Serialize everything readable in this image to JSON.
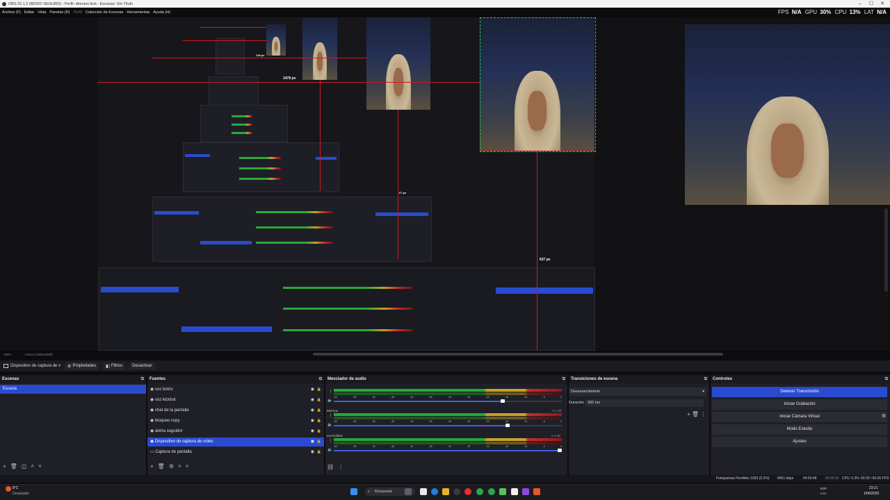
{
  "window": {
    "title": "OBS 31.1.2 (MODO SEGURO) - Perfil: directos kick - Escenas: Sin Título",
    "controls": [
      "–",
      "☐",
      "✕"
    ]
  },
  "menu": {
    "items": [
      "Archivo (F)",
      "Editar",
      "Vista",
      "Paneles (D)",
      "Perfil",
      "Colección de Escenas",
      "Herramientas",
      "Ayuda (H)"
    ]
  },
  "stats": {
    "fps_label": "FPS",
    "fps_value": "N/A",
    "gpu_label": "GPU",
    "gpu_value": "30%",
    "cpu_label": "CPU",
    "cpu_value": "13%",
    "lat_label": "LAT",
    "lat_value": "N/A"
  },
  "preview": {
    "measure_top": "1478 px",
    "measure_mid": "149 px",
    "measure_bottom": "637 px",
    "measure_small": "67 px",
    "zoom": "100%",
    "canvas": "Lienzo (1920x1080)"
  },
  "source_toolbar": {
    "source_name": "Dispositivo de captura de v",
    "properties": "Propiedades",
    "filters": "Filtros",
    "deactivate": "Desactivar"
  },
  "scenes": {
    "title": "Escenas",
    "items": [
      "Escena"
    ]
  },
  "sources": {
    "title": "Fuentes",
    "items": [
      "voz botriv",
      "voz kickbot",
      "chat de la pantalla",
      "bloqueo copy",
      "alerta seguidor",
      "Dispositivo de captura de vídeo",
      "Captura de pantalla"
    ],
    "selected_index": 5
  },
  "audio": {
    "title": "Mezclador de audio",
    "ticks": [
      "-60",
      "-55",
      "-50",
      "-45",
      "-40",
      "-35",
      "-30",
      "-25",
      "-20",
      "-15",
      "-10",
      "-5",
      "0"
    ],
    "channels": [
      {
        "name": "",
        "db": "",
        "volume": 0.75
      },
      {
        "name": "Mic/Aux",
        "db": "-0.2 dB",
        "volume": 0.77
      },
      {
        "name": "voz kickbot",
        "db": "0.0 dB",
        "volume": 1.0
      }
    ]
  },
  "transitions": {
    "title": "Transiciones de escena",
    "selected": "Desvanecimiento",
    "duration_label": "Duración",
    "duration_value": "300 ms"
  },
  "controls": {
    "title": "Controles",
    "buttons": [
      "Detener Transmisión",
      "Iniciar Grabación",
      "Iniciar Cámara Virtual",
      "Modo Estudio",
      "Ajustes"
    ],
    "active_index": 0
  },
  "status": {
    "dropped": "Fotogramas Perdidos 1653 (0.2%)",
    "bitrate": "8461 kbps",
    "stream_time": "04:53:48",
    "rec_time": "00:00:00",
    "cpu": "CPU: 0.3%",
    "fps": "60.00 / 60.00 FPS"
  },
  "taskbar": {
    "weather_temp": "8°C",
    "weather_desc": "Despejado",
    "search": "Búsqueda",
    "lang": "ESP",
    "region": "LAA",
    "time": "23:21",
    "date": "1/06/2025"
  },
  "colors": {
    "accent": "#2a4bd0",
    "guide_red": "#d0181f",
    "guide_green": "#2ad04a",
    "panel": "#1f2027"
  }
}
